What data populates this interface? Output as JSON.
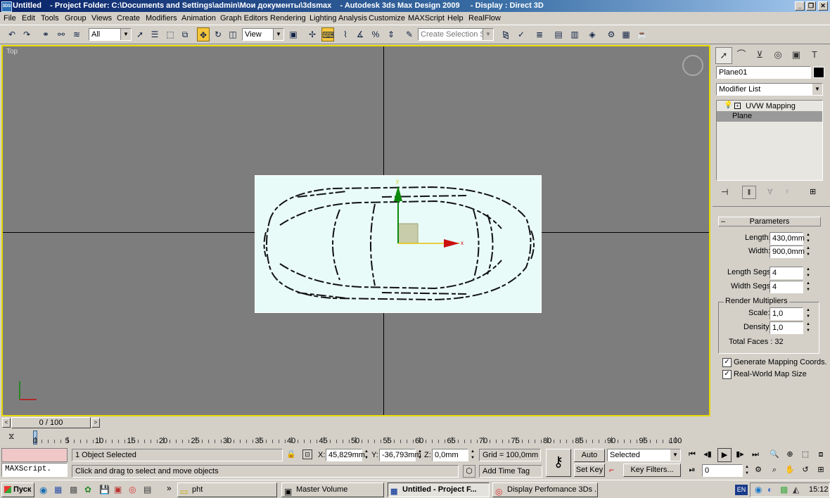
{
  "window": {
    "title": "Untitled    - Project Folder: C:\\Documents and Settings\\admin\\Мои документы\\3dsmax    - Autodesk 3ds Max Design 2009     - Display : Direct 3D"
  },
  "menu": [
    "File",
    "Edit",
    "Tools",
    "Group",
    "Views",
    "Create",
    "Modifiers",
    "Animation",
    "Graph Editors",
    "Rendering",
    "Lighting Analysis",
    "Customize",
    "MAXScript",
    "Help",
    "RealFlow"
  ],
  "toolbar": {
    "filter_value": "All",
    "refcoord_value": "View",
    "selection_set_placeholder": "Create Selection Set"
  },
  "viewport": {
    "label": "Top",
    "axis_y": "y",
    "axis_x": "x",
    "border_color": "#e6d800"
  },
  "command_panel": {
    "object_name": "Plane01",
    "modifier_list": "Modifier List",
    "stack": [
      "UVW Mapping",
      "Plane"
    ],
    "rollout": "Parameters",
    "length_label": "Length:",
    "length_value": "430,0mm",
    "width_label": "Width:",
    "width_value": "900,0mm",
    "length_segs_label": "Length Segs:",
    "length_segs_value": "4",
    "width_segs_label": "Width Segs:",
    "width_segs_value": "4",
    "render_mult_label": "Render Multipliers",
    "scale_label": "Scale:",
    "scale_value": "1,0",
    "density_label": "Density:",
    "density_value": "1,0",
    "total_faces": "Total Faces : 32",
    "gen_mapping_label": "Generate Mapping Coords.",
    "real_world_label": "Real-World Map Size"
  },
  "timeline": {
    "frame_display": "0 / 100",
    "ticks": [
      "0",
      "5",
      "10",
      "15",
      "20",
      "25",
      "30",
      "35",
      "40",
      "45",
      "50",
      "55",
      "60",
      "65",
      "70",
      "75",
      "80",
      "85",
      "90",
      "95",
      "100"
    ]
  },
  "status": {
    "maxscript": "MAXScript.",
    "selected": "1 Object Selected",
    "prompt": "Click and drag to select and move objects",
    "x_label": "X:",
    "x_value": "45,829mm",
    "y_label": "Y:",
    "y_value": "-36,793mm",
    "z_label": "Z:",
    "z_value": "0,0mm",
    "grid": "Grid = 100,0mm",
    "add_time_tag": "Add Time Tag",
    "auto_key": "Auto Key",
    "set_key": "Set Key",
    "key_mode": "Selected",
    "key_filters": "Key Filters...",
    "frame_value": "0"
  },
  "taskbar": {
    "start": "Пуск",
    "tasks": [
      "pht",
      "Master Volume",
      "Untitled    - Project F...",
      "Display Perfomance 3Ds ..."
    ],
    "lang": "EN",
    "clock": "15:12"
  }
}
